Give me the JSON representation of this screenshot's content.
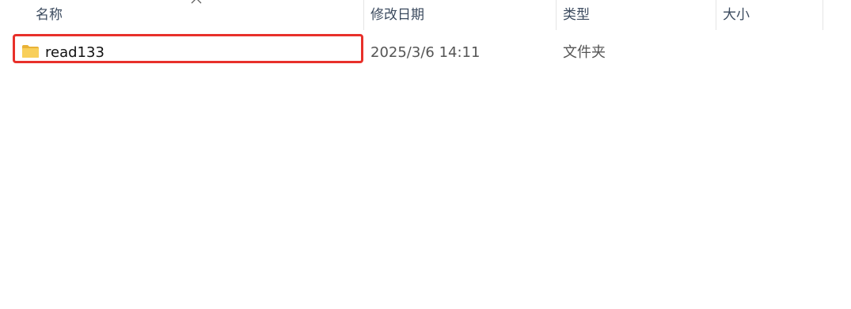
{
  "columns": {
    "name": "名称",
    "date": "修改日期",
    "type": "类型",
    "size": "大小"
  },
  "sort": {
    "indicator_icon": "chevron-up-icon"
  },
  "rows": [
    {
      "icon": "folder-icon",
      "name": "read133",
      "date": "2025/3/6 14:11",
      "type": "文件夹",
      "size": ""
    }
  ],
  "colors": {
    "highlight": "#e8302a",
    "folder": "#f5c64e"
  }
}
